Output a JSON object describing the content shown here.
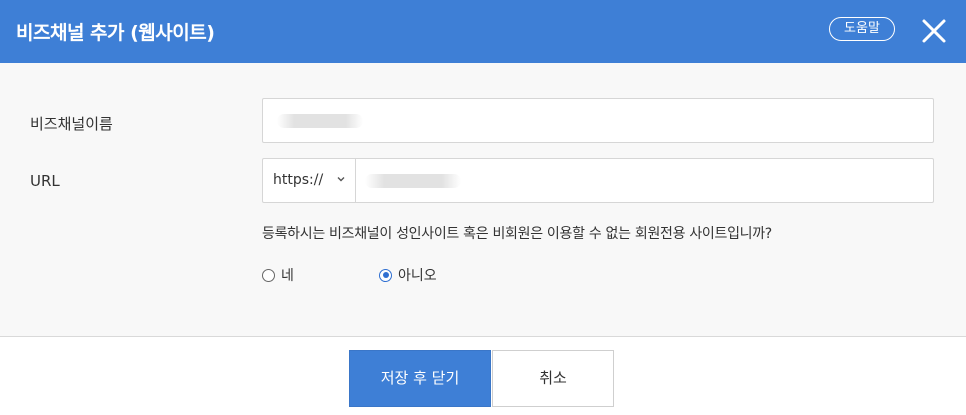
{
  "dialog": {
    "title": "비즈채널 추가 (웹사이트)",
    "help_label": "도움말",
    "close_icon": "close-icon",
    "accent_color": "#3e7fd6"
  },
  "form": {
    "name_label": "비즈채널이름",
    "url_label": "URL",
    "protocol_selected": "https://",
    "question": "등록하시는 비즈채널이 성인사이트 혹은 비회원은 이용할 수 없는 회원전용 사이트입니까?",
    "options": [
      {
        "label": "네",
        "checked": false
      },
      {
        "label": "아니오",
        "checked": true
      }
    ]
  },
  "footer": {
    "save_label": "저장 후 닫기",
    "cancel_label": "취소"
  }
}
